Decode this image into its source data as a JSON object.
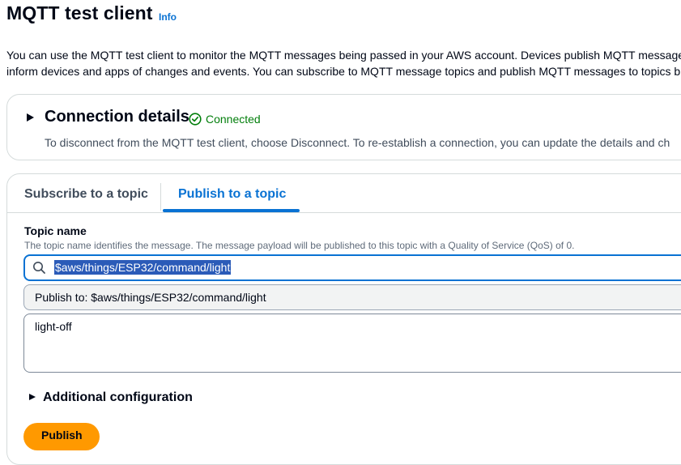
{
  "header": {
    "title": "MQTT test client",
    "info_link": "Info",
    "description_line1": "You can use the MQTT test client to monitor the MQTT messages being passed in your AWS account. Devices publish MQTT message",
    "description_line2": "inform devices and apps of changes and events. You can subscribe to MQTT message topics and publish MQTT messages to topics b"
  },
  "connection": {
    "title": "Connection details",
    "status": "Connected",
    "status_color": "#037f0c",
    "description": "To disconnect from the MQTT test client, choose Disconnect. To re-establish a connection, you can update the details and ch"
  },
  "tabs": {
    "items": [
      {
        "label": "Subscribe to a topic",
        "active": false
      },
      {
        "label": "Publish to a topic",
        "active": true
      }
    ],
    "accent_color": "#0972d3"
  },
  "publish_form": {
    "topic_label": "Topic name",
    "topic_description": "The topic name identifies the message. The message payload will be published to this topic with a Quality of Service (QoS) of 0.",
    "topic_value": "$aws/things/ESP32/command/light",
    "suggestion": "Publish to: $aws/things/ESP32/command/light",
    "payload": "light-off",
    "additional_config": "Additional configuration",
    "publish_button": "Publish",
    "button_color": "#ff9900"
  },
  "icons": {
    "expand": "caret-right-icon",
    "status": "check-circle-icon",
    "search": "search-icon"
  }
}
